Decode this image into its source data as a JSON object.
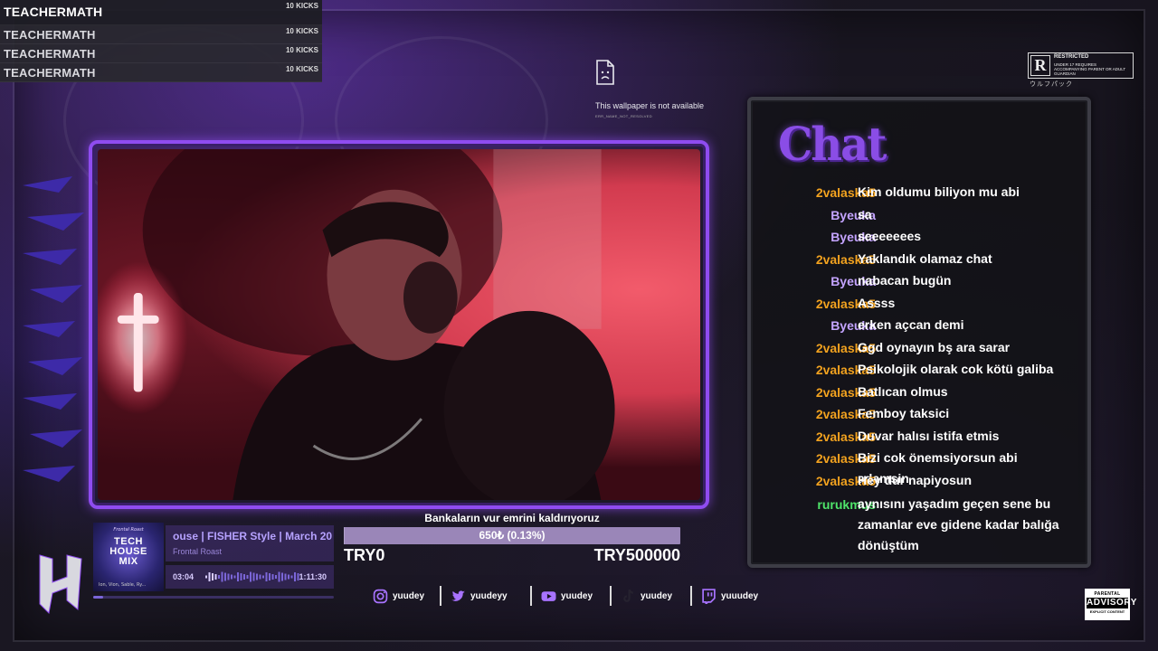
{
  "kicks": [
    {
      "name": "TEACHERMATH",
      "count": "10 KICKS"
    },
    {
      "name": "TEACHERMATH",
      "count": "10 KICKS"
    },
    {
      "name": "TEACHERMATH",
      "count": "10 KICKS"
    },
    {
      "name": "TEACHERMATH",
      "count": "10 KICKS"
    }
  ],
  "wallpaper": {
    "message": "This wallpaper is not available",
    "error_code": "ERR_NAME_NOT_RESOLVED"
  },
  "restricted_badge": {
    "letter": "R",
    "title": "RESTRICTED",
    "subtitle": "UNDER 17 REQUIRES ACCOMPANYING PARENT OR ADULT GUARDIAN",
    "katakana": "ウルフパック"
  },
  "chat": {
    "title": "Chat",
    "colors": {
      "orange": "#f2a21f",
      "purple": "#c4a4ff",
      "green": "#4fe56a"
    },
    "messages": [
      {
        "user": "2valaska5",
        "color": "orange",
        "text": "Kim oldumu biliyon mu abi"
      },
      {
        "user": "Byeuka",
        "color": "purple",
        "text": "sa"
      },
      {
        "user": "Byeuka",
        "color": "purple",
        "text": "seeeeeees"
      },
      {
        "user": "2valaska5",
        "color": "orange",
        "text": "Yaklandık olamaz chat"
      },
      {
        "user": "Byeuka",
        "color": "purple",
        "text": "nabacan bugün"
      },
      {
        "user": "2valaska5",
        "color": "orange",
        "text": "Assss"
      },
      {
        "user": "Byeuka",
        "color": "purple",
        "text": "erken açcan demi"
      },
      {
        "user": "2valaska5",
        "color": "orange",
        "text": "Ggd oynayın bş ara sarar"
      },
      {
        "user": "2valaska5",
        "color": "orange",
        "text": "Psikolojik olarak cok kötü galiba"
      },
      {
        "user": "2valaska5",
        "color": "orange",
        "text": "Batlıcan olmus"
      },
      {
        "user": "2valaska5",
        "color": "orange",
        "text": "Femboy taksici"
      },
      {
        "user": "2valaska5",
        "color": "orange",
        "text": "Duvar halısı istifa etmis"
      },
      {
        "user": "2valaska5",
        "color": "orange",
        "text": "Bizi cok önemsiyorsun abi adamsin"
      },
      {
        "user": "2valaska5",
        "color": "orange",
        "text": "Hey dur napiyosun"
      },
      {
        "user": "rurukmus",
        "color": "green",
        "text": "aynısını yaşadım geçen sene bu zamanlar eve gidene kadar balığa dönüştüm"
      }
    ]
  },
  "goal": {
    "title": "Bankaların vur emrini kaldırıyoruz",
    "value": "650₺ (0.13%)",
    "progress_percent": 0.13,
    "min_label": "TRY0",
    "max_label": "TRY500000"
  },
  "music": {
    "cover_line1": "Frontal Roast",
    "cover_title": "TECH HOUSE MIX",
    "cover_line3": "Ion, Vion, Sable, Ry...",
    "track_title": "ouse | FISHER Style | March 20",
    "artist": "Frontal Roast",
    "time_current": "03:04",
    "time_total": "1:11:30",
    "progress_fraction": 0.043
  },
  "socials": [
    {
      "icon": "instagram-icon",
      "handle": "yuudey"
    },
    {
      "icon": "twitter-icon",
      "handle": "yuudeyy"
    },
    {
      "icon": "youtube-icon",
      "handle": "yuudey"
    },
    {
      "icon": "tiktok-icon",
      "handle": "yuudey"
    },
    {
      "icon": "twitch-icon",
      "handle": "yuuudey"
    }
  ],
  "parental_advisory": {
    "top": "PARENTAL",
    "middle": "ADVISORY",
    "bottom": "EXPLICIT CONTENT"
  },
  "accent_color": "#8f4cf0"
}
